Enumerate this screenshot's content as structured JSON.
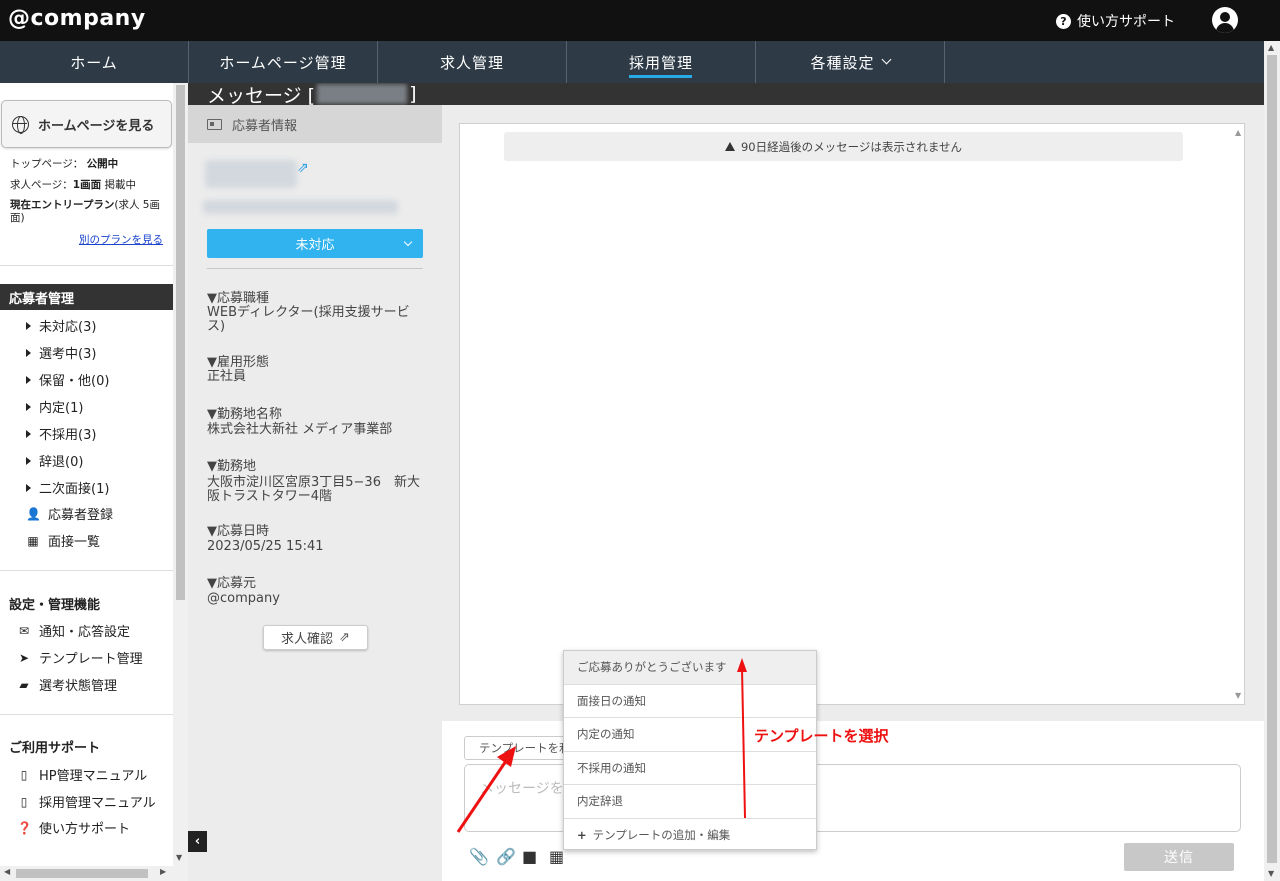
{
  "header": {
    "logo": "@company",
    "help_label": "使い方サポート",
    "help_icon": "?"
  },
  "nav": {
    "tabs": [
      {
        "label": "ホーム"
      },
      {
        "label": "ホームページ管理"
      },
      {
        "label": "求人管理"
      },
      {
        "label": "採用管理",
        "active": true
      },
      {
        "label": "各種設定"
      }
    ]
  },
  "sidebar": {
    "hp_button": "ホームページを見る",
    "top_page_label": "トップページ：",
    "top_page_value": "公開中",
    "job_page_label": "求人ページ：",
    "job_page_value": "1画面",
    "job_page_suffix": "掲載中",
    "plan_label": "現在エントリープラン",
    "plan_detail": "(求人 5画面)",
    "plan_link": "別のプランを見る",
    "applicant_section": "応募者管理",
    "applicant_items": [
      "未対応(3)",
      "選考中(3)",
      "保留・他(0)",
      "内定(1)",
      "不採用(3)",
      "辞退(0)",
      "二次面接(1)"
    ],
    "register_label": "応募者登録",
    "interview_label": "面接一覧",
    "settings_section": "設定・管理機能",
    "settings_items": [
      "通知・応答設定",
      "テンプレート管理",
      "選考状態管理"
    ],
    "support_section": "ご利用サポート",
    "support_items": [
      "HP管理マニュアル",
      "採用管理マニュアル",
      "使い方サポート"
    ]
  },
  "page": {
    "title_prefix": "メッセージ [",
    "title_suffix": "]"
  },
  "applicant": {
    "header": "応募者情報",
    "status": "未対応",
    "fields": [
      {
        "label": "▼応募職種",
        "value": "WEBディレクター(採用支援サービス)"
      },
      {
        "label": "▼雇用形態",
        "value": "正社員"
      },
      {
        "label": "▼勤務地名称",
        "value": "株式会社大新社 メディア事業部"
      },
      {
        "label": "▼勤務地",
        "value": "大阪市淀川区宮原3丁目5−36　新大阪トラストタワー4階"
      },
      {
        "label": "▼応募日時",
        "value": "2023/05/25 15:41"
      },
      {
        "label": "▼応募元",
        "value": "@company"
      }
    ],
    "job_check_button": "求人確認"
  },
  "messages": {
    "notice": "90日経過後のメッセージは表示されません"
  },
  "compose": {
    "template_select": "テンプレートを利用",
    "placeholder": "メッセージを入力",
    "send": "送信"
  },
  "dropdown": {
    "items": [
      "ご応募ありがとうございます",
      "面接日の通知",
      "内定の通知",
      "不採用の通知",
      "内定辞退"
    ],
    "add_item": "テンプレートの追加・編集"
  },
  "annotation": {
    "text": "テンプレートを選択",
    "color": "#ee1111"
  },
  "colors": {
    "accent": "#31b3ef",
    "nav_bg": "#2e3b47",
    "topbar_bg": "#111111"
  }
}
